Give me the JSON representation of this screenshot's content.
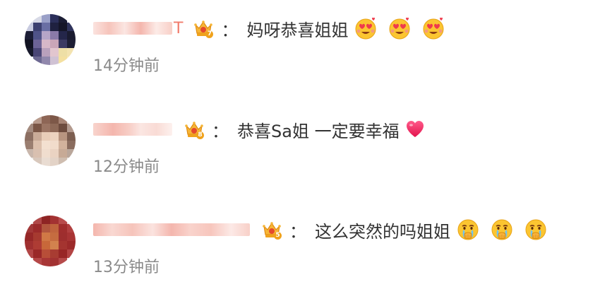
{
  "comments": [
    {
      "nickname_tail": "T",
      "vip_level": "7",
      "colon": "：",
      "text": "妈呀恭喜姐姐",
      "emojis": [
        "heart-eyes-emoji",
        "heart-eyes-emoji",
        "heart-eyes-emoji"
      ],
      "time": "14分钟前"
    },
    {
      "nickname_tail": "",
      "vip_level": "8",
      "colon": "：",
      "text": "恭喜Sa姐 一定要幸福",
      "emojis": [
        "red-heart-emoji"
      ],
      "time": "12分钟前"
    },
    {
      "nickname_tail": "",
      "vip_level": "5",
      "colon": "：",
      "text": "这么突然的吗姐姐",
      "emojis": [
        "crying-emoji",
        "crying-emoji",
        "crying-emoji"
      ],
      "time": "13分钟前"
    }
  ],
  "colors": {
    "text": "#333333",
    "time": "#8a8a8a",
    "nickname_blur": "#f4b6ad",
    "vip_gold": "#f0a21c"
  }
}
